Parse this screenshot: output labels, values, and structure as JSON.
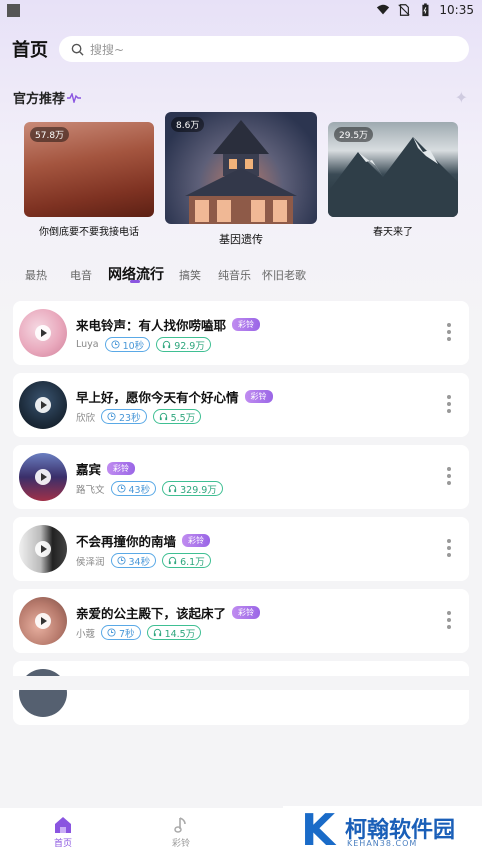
{
  "status_bar": {
    "time": "10:35"
  },
  "header": {
    "title": "首页",
    "search_placeholder": "搜搜~"
  },
  "section": {
    "title": "官方推荐"
  },
  "featured": [
    {
      "count": "57.8万",
      "caption": "你倒底要不要我接电话"
    },
    {
      "count": "8.6万",
      "caption": "基因遗传"
    },
    {
      "count": "29.5万",
      "caption": "春天来了"
    }
  ],
  "tabs": [
    {
      "label": "最热"
    },
    {
      "label": "电音"
    },
    {
      "label": "网络流行"
    },
    {
      "label": "搞笑"
    },
    {
      "label": "纯音乐"
    },
    {
      "label": "怀旧老歌"
    }
  ],
  "active_tab_index": 2,
  "badge_label": "彩铃",
  "songs": [
    {
      "title": "来电铃声：有人找你唠嗑耶",
      "artist": "Luya",
      "duration": "10秒",
      "plays": "92.9万"
    },
    {
      "title": "早上好，愿你今天有个好心情",
      "artist": "欣欣",
      "duration": "23秒",
      "plays": "5.5万"
    },
    {
      "title": "嘉宾",
      "artist": "路飞文",
      "duration": "43秒",
      "plays": "329.9万"
    },
    {
      "title": "不会再撞你的南墙",
      "artist": "侯泽润",
      "duration": "34秒",
      "plays": "6.1万"
    },
    {
      "title": "亲爱的公主殿下，该起床了",
      "artist": "小蔻",
      "duration": "7秒",
      "plays": "14.5万"
    }
  ],
  "bottom_nav": [
    {
      "label": "首页",
      "icon": "home-icon"
    },
    {
      "label": "彩铃",
      "icon": "music-note-icon"
    }
  ],
  "watermark": {
    "logo": "K",
    "name": "柯翰软件园",
    "url": "KEHAN38.COM"
  },
  "colors": {
    "accent": "#8a55e0",
    "duration": "#4a98d8",
    "plays": "#2ea67d"
  }
}
